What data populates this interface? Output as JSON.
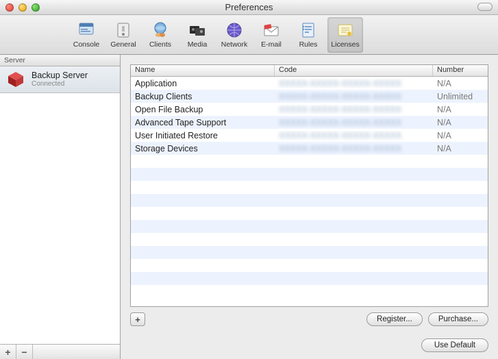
{
  "window": {
    "title": "Preferences"
  },
  "toolbar": {
    "items": [
      {
        "label": "Console"
      },
      {
        "label": "General"
      },
      {
        "label": "Clients"
      },
      {
        "label": "Media"
      },
      {
        "label": "Network"
      },
      {
        "label": "E-mail"
      },
      {
        "label": "Rules"
      },
      {
        "label": "Licenses"
      }
    ],
    "selected": "Licenses"
  },
  "sidebar": {
    "header": "Server",
    "server": {
      "name": "Backup Server",
      "status": "Connected"
    },
    "add_label": "+",
    "remove_label": "−"
  },
  "table": {
    "columns": {
      "name": "Name",
      "code": "Code",
      "number": "Number"
    },
    "rows": [
      {
        "name": "Application",
        "code": "XXXXX-XXXXX-XXXXX-XXXXX",
        "number": "N/A"
      },
      {
        "name": "Backup Clients",
        "code": "XXXXX-XXXXX-XXXXX-XXXXX",
        "number": "Unlimited"
      },
      {
        "name": "Open File Backup",
        "code": "XXXXX-XXXXX-XXXXX-XXXXX",
        "number": "N/A"
      },
      {
        "name": "Advanced Tape Support",
        "code": "XXXXX-XXXXX-XXXXX-XXXXX",
        "number": "N/A"
      },
      {
        "name": "User Initiated Restore",
        "code": "XXXXX-XXXXX-XXXXX-XXXXX",
        "number": "N/A"
      },
      {
        "name": "Storage Devices",
        "code": "XXXXX-XXXXX-XXXXX-XXXXX",
        "number": "N/A"
      }
    ],
    "empty_rows": 10
  },
  "buttons": {
    "add": "+",
    "register": "Register...",
    "purchase": "Purchase...",
    "use_default": "Use Default"
  }
}
